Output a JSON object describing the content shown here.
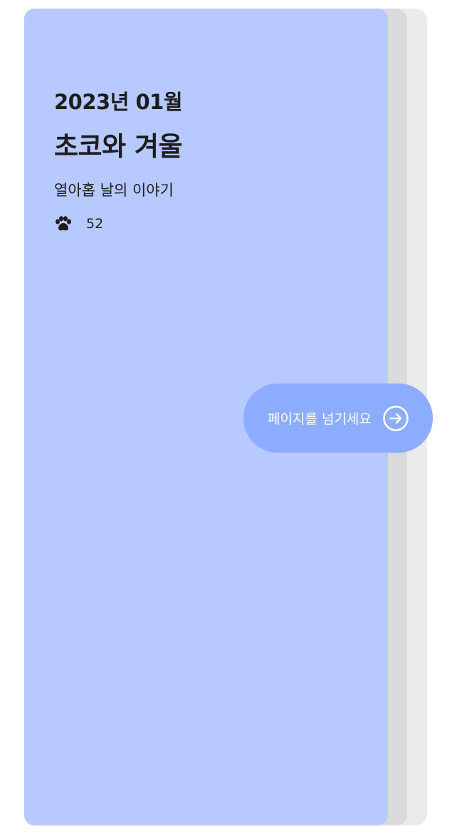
{
  "colors": {
    "cover_background": "#b7c9fe",
    "button_background": "#8cacff",
    "text_primary": "#1d1d1f",
    "page_stack_mid": "#dadada",
    "page_stack_back": "#ebebeb"
  },
  "cover": {
    "date": "2023년 01월",
    "title": "초코와 겨울",
    "subtitle": "열아홉 날의 이야기",
    "paw_icon": "paw-icon",
    "paw_count": "52"
  },
  "page_turn_button": {
    "label": "페이지를 넘기세요",
    "icon": "arrow-right-circle-icon"
  }
}
